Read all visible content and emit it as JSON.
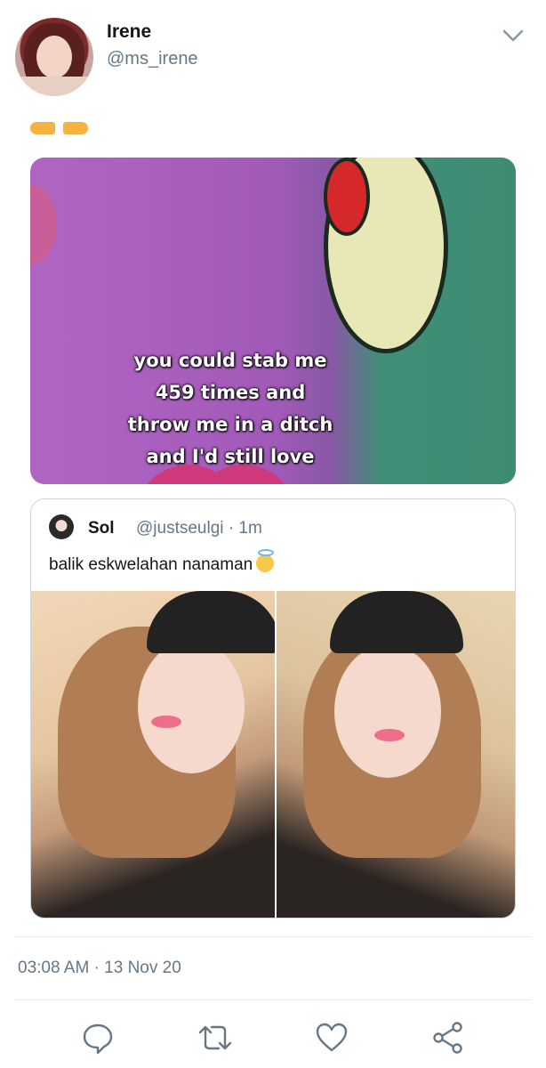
{
  "tweet": {
    "display_name": "Irene",
    "handle": "@ms_irene",
    "text_emoji": "👉👈",
    "media_caption": [
      "you could stab me",
      "459 times and",
      "throw me in a ditch",
      "and I'd still love"
    ],
    "timestamp": "03:08 AM · 13 Nov 20"
  },
  "quoted": {
    "display_name": "Sol",
    "meta": "@justseulgi · 1m",
    "text": "balik eskwelahan nanaman"
  },
  "icons": {
    "menu": "chevron-down-icon",
    "reply": "reply-icon",
    "retweet": "retweet-icon",
    "like": "heart-icon",
    "share": "share-icon"
  },
  "colors": {
    "secondary_text": "#657786",
    "border": "#ccd6dd"
  }
}
